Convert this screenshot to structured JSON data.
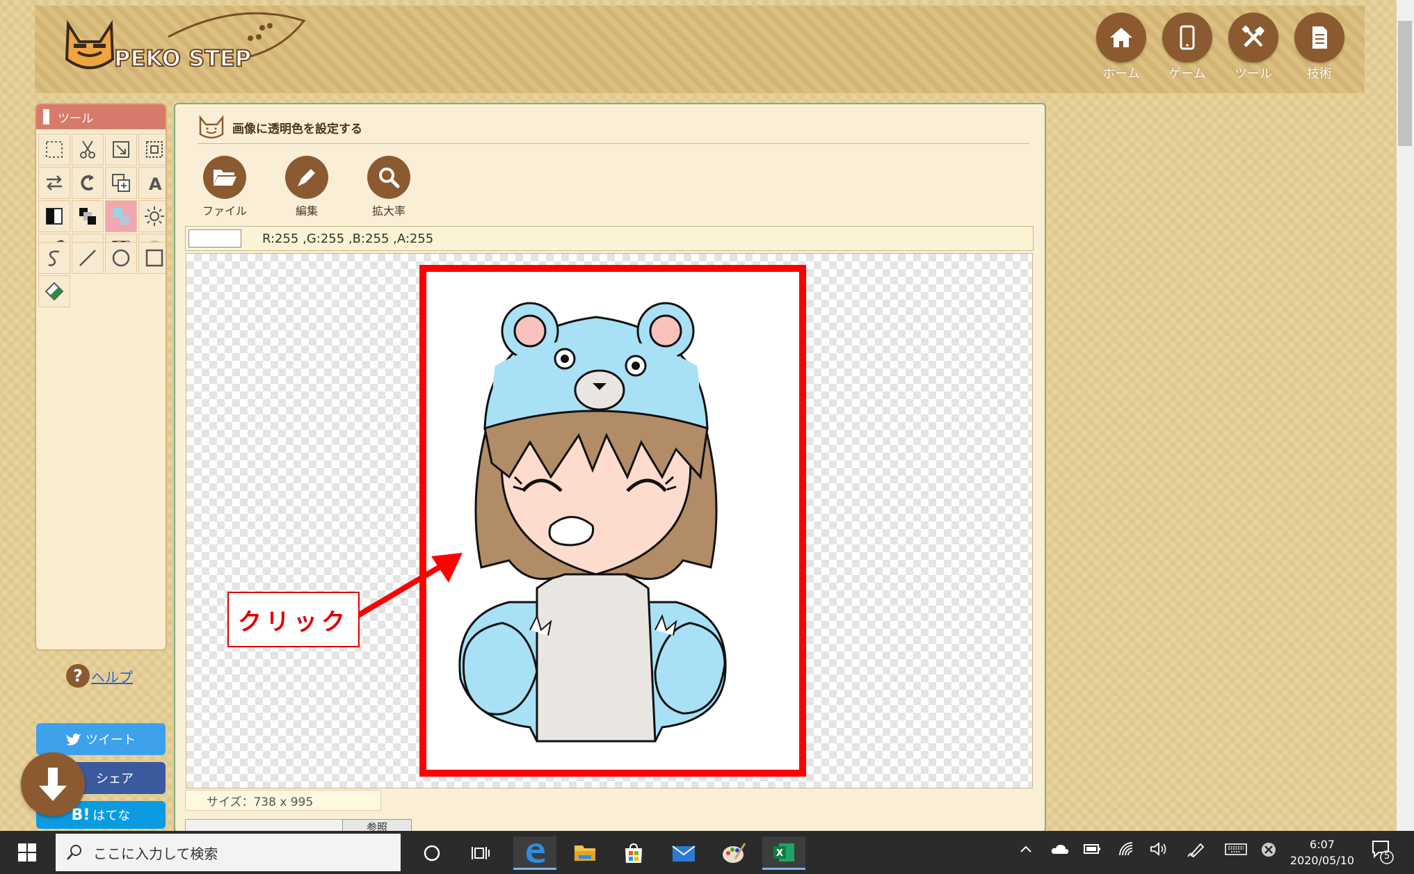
{
  "logo": {
    "text": "PEKO STEP"
  },
  "nav": [
    {
      "label": "ホーム",
      "icon": "home-icon"
    },
    {
      "label": "ゲーム",
      "icon": "smartphone-icon"
    },
    {
      "label": "ツール",
      "icon": "tools-icon"
    },
    {
      "label": "技術",
      "icon": "document-icon"
    }
  ],
  "tool_panel": {
    "title": "ツール",
    "tools_row": [
      "select-rect-icon",
      "scissors-icon",
      "resize-icon",
      "crop-icon",
      "flip-icon",
      "rotate-icon",
      "copy-layer-icon",
      "text-icon",
      "invert-icon",
      "grayscale-icon",
      "transparent-color-icon",
      "brightness-icon",
      "eyedropper-icon",
      "blur-icon",
      "mosaic-icon",
      "color-circle-icon"
    ],
    "draw_tools": [
      "freehand-icon",
      "line-icon",
      "circle-icon",
      "rectangle-icon",
      "eraser-icon"
    ],
    "active_tool": "transparent-color-icon"
  },
  "help": {
    "label": "ヘルプ"
  },
  "share": {
    "tweet": "ツイート",
    "share": "シェア",
    "hatena": "はてな",
    "hatena_logo": "B!"
  },
  "main": {
    "title": "画像に透明色を設定する",
    "actions": [
      {
        "label": "ファイル",
        "icon": "folder-icon"
      },
      {
        "label": "編集",
        "icon": "pencil-icon"
      },
      {
        "label": "拡大率",
        "icon": "magnifier-icon"
      }
    ],
    "color_readout": "R:255 ,G:255 ,B:255 ,A:255",
    "size_readout": "サイズ：738 x 995",
    "browse_label": "参照"
  },
  "annotation": {
    "label": "クリック"
  },
  "taskbar": {
    "search_placeholder": "ここに入力して検索",
    "time": "6:07",
    "date": "2020/05/10",
    "notification_count": "5"
  },
  "colors": {
    "brand_brown": "#8b5a31",
    "highlight_red": "#ff0000",
    "bear_blue": "#a8e1f5"
  }
}
